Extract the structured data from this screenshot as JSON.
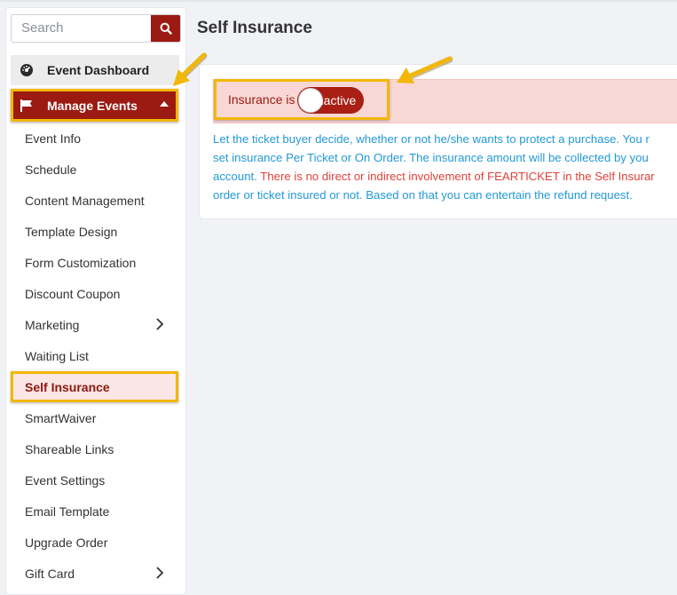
{
  "search": {
    "placeholder": "Search"
  },
  "sidebar": {
    "dashboard_label": "Event Dashboard",
    "manage_label": "Manage Events",
    "items": [
      {
        "label": "Event Info"
      },
      {
        "label": "Schedule"
      },
      {
        "label": "Content Management"
      },
      {
        "label": "Template Design"
      },
      {
        "label": "Form Customization"
      },
      {
        "label": "Discount Coupon"
      },
      {
        "label": "Marketing"
      },
      {
        "label": "Waiting List"
      },
      {
        "label": "Self Insurance"
      },
      {
        "label": "SmartWaiver"
      },
      {
        "label": "Shareable Links"
      },
      {
        "label": "Event Settings"
      },
      {
        "label": "Email Template"
      },
      {
        "label": "Upgrade Order"
      },
      {
        "label": "Gift Card"
      }
    ]
  },
  "main": {
    "title": "Self Insurance",
    "insurance_label": "Insurance is",
    "toggle_state": "Inactive",
    "description": {
      "line1": "Let the ticket buyer decide, whether or not he/she wants to protect a purchase. You r",
      "line2": "set insurance Per Ticket or On Order. The insurance amount will be collected by you",
      "line3_blue": "account. ",
      "line3_red": "There is no direct or indirect involvement of FEARTICKET in the Self Insurar",
      "line4": "order or ticket insured or not. Based on that you can entertain the refund request."
    }
  },
  "colors": {
    "brand": "#9b1a12",
    "highlight": "#f2b707",
    "info_text": "#2399d6",
    "warning_text": "#e0423b",
    "banner_bg": "#f8d7d5"
  },
  "icons": {
    "search": "search-icon",
    "dashboard": "dashboard-gauge-icon",
    "manage": "flag-icon",
    "expand": "chevron-right-icon",
    "annotation": "arrow-annotation-icon"
  }
}
